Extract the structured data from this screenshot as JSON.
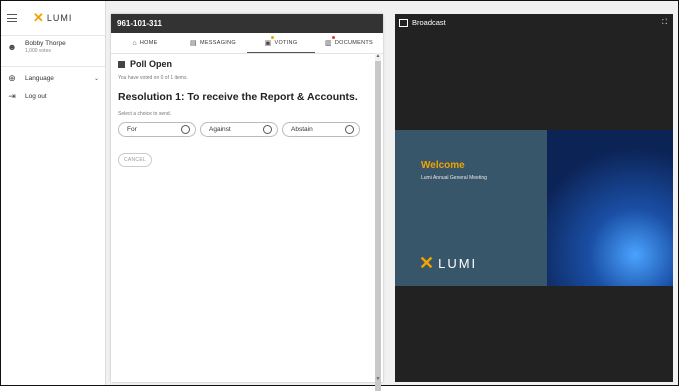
{
  "sidebar": {
    "brand": "LUMI",
    "user_name": "Bobby Thorpe",
    "user_votes": "1,000 votes",
    "language_label": "Language",
    "logout_label": "Log out"
  },
  "panel": {
    "meeting_id": "961-101-311",
    "tabs": [
      {
        "label": "HOME"
      },
      {
        "label": "MESSAGING"
      },
      {
        "label": "VOTING"
      },
      {
        "label": "DOCUMENTS"
      }
    ],
    "poll_title": "Poll Open",
    "voted_status": "You have voted on 0 of 1 items.",
    "resolution": "Resolution 1: To receive the Report & Accounts.",
    "select_hint": "Select a choice to send.",
    "choices": [
      {
        "label": "For"
      },
      {
        "label": "Against"
      },
      {
        "label": "Abstain"
      }
    ],
    "cancel_label": "CANCEL"
  },
  "broadcast": {
    "title": "Broadcast",
    "welcome": "Welcome",
    "subtitle": "Lumi Annual General Meeting",
    "logo_text": "LUMI"
  },
  "colors": {
    "accent": "#f2a300",
    "header_dark": "#333333",
    "broadcast_bg": "#222222",
    "notify_orange": "#f2a300",
    "notify_red": "#e53935"
  }
}
